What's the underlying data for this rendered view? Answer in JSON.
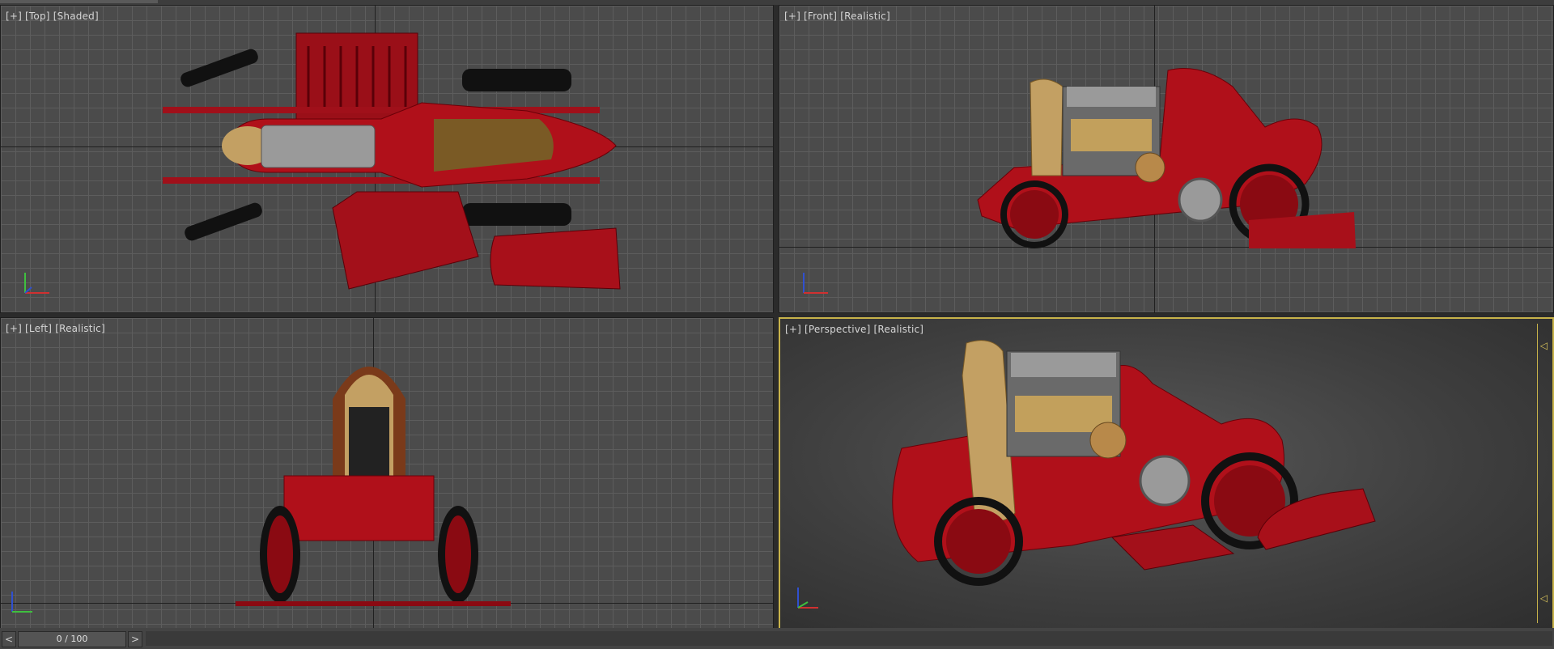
{
  "viewports": {
    "top": {
      "plus": "[+]",
      "view": "[Top]",
      "shading": "[Shaded]"
    },
    "front": {
      "plus": "[+]",
      "view": "[Front]",
      "shading": "[Realistic]"
    },
    "left": {
      "plus": "[+]",
      "view": "[Left]",
      "shading": "[Realistic]"
    },
    "perspective": {
      "plus": "[+]",
      "view": "[Perspective]",
      "shading": "[Realistic]"
    }
  },
  "timeline": {
    "prev": "<",
    "frame": "0 / 100",
    "next": ">"
  },
  "colors": {
    "car_red": "#b0101a",
    "engine_gray": "#8a8a8a",
    "brass": "#b89a55",
    "active_border": "#c8b34a"
  }
}
